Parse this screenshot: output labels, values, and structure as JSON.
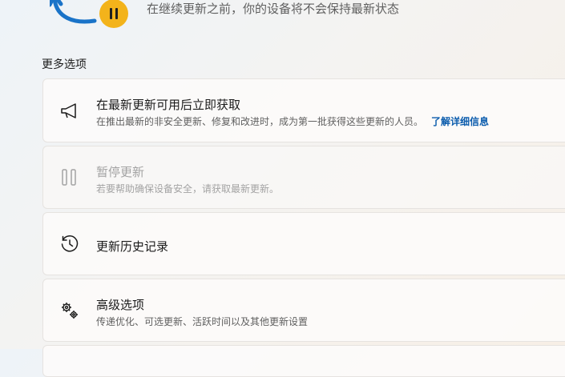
{
  "status": {
    "text": "在继续更新之前，你的设备将不会保持最新状态"
  },
  "more_options": {
    "title": "更多选项",
    "items": [
      {
        "icon": "megaphone-icon",
        "title": "在最新更新可用后立即获取",
        "desc": "在推出最新的非安全更新、修复和改进时，成为第一批获得这些更新的人员。",
        "link": "了解详细信息"
      },
      {
        "icon": "pause-icon",
        "title": "暂停更新",
        "desc": "若要帮助确保设备安全，请获取最新更新。",
        "disabled": true
      },
      {
        "icon": "history-icon",
        "title": "更新历史记录"
      },
      {
        "icon": "gears-icon",
        "title": "高级选项",
        "desc": "传递优化、可选更新、活跃时间以及其他更新设置"
      }
    ]
  },
  "colors": {
    "accent": "#0b5cad",
    "warning_badge": "#f3b31b",
    "arrow": "#1a73c8"
  }
}
